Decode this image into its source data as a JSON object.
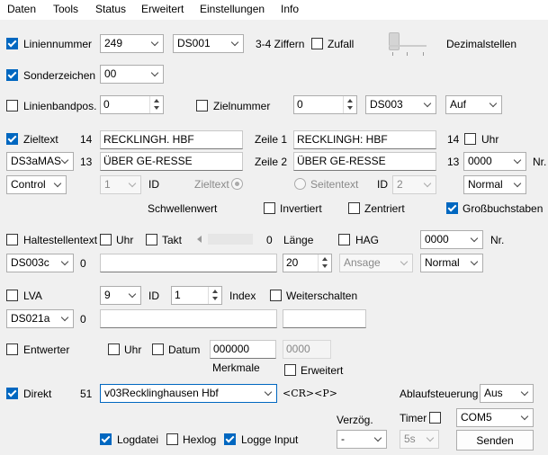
{
  "menu": [
    "Daten",
    "Tools",
    "Status",
    "Erweitert",
    "Einstellungen",
    "Info"
  ],
  "row1": {
    "label": "Liniennummer",
    "value": "249",
    "ds": "DS001",
    "hint": "3-4 Ziffern",
    "zufall": "Zufall",
    "dezimal": "Dezimalstellen"
  },
  "row2": {
    "label": "Sonderzeichen",
    "value": "00"
  },
  "row3": {
    "label": "Linienbandpos.",
    "value": "0",
    "zielnummer_label": "Zielnummer",
    "zielnummer_value": "0",
    "ds": "DS003",
    "mode": "Auf"
  },
  "row4": {
    "label": "Zieltext",
    "count1": "14",
    "text1": "RECKLINGH. HBF",
    "zeile1": "Zeile 1",
    "text2": "RECKLINGH: HBF",
    "count2": "14",
    "uhr": "Uhr"
  },
  "row5": {
    "ds": "DS3aMAS",
    "count1": "13",
    "text1": "ÜBER GE-RESSE",
    "zeile2": "Zeile 2",
    "text2": "ÜBER GE-RESSE",
    "count2": "13",
    "nr_value": "0000",
    "nr_label": "Nr."
  },
  "row6": {
    "control": "Control",
    "id_value": "1",
    "id_label": "ID",
    "zieltext": "Zieltext",
    "seitentext": "Seitentext",
    "id2_label": "ID",
    "id2_value": "2",
    "normal": "Normal"
  },
  "row7": {
    "schwellenwert": "Schwellenwert",
    "invertiert": "Invertiert",
    "zentriert": "Zentriert",
    "gross": "Großbuchstaben"
  },
  "row8": {
    "label": "Haltestellentext",
    "uhr": "Uhr",
    "takt": "Takt",
    "takt_value": "0",
    "laenge": "Länge",
    "hag": "HAG",
    "nr_value": "0000",
    "nr_label": "Nr."
  },
  "row9": {
    "ds": "DS003c",
    "count": "0",
    "spin_value": "20",
    "ansage": "Ansage",
    "normal": "Normal"
  },
  "row10": {
    "label": "LVA",
    "value": "9",
    "id_label": "ID",
    "id_value": "1",
    "index": "Index",
    "weiterschalten": "Weiterschalten"
  },
  "row11": {
    "ds": "DS021a",
    "count": "0"
  },
  "row12": {
    "label": "Entwerter",
    "uhr": "Uhr",
    "datum": "Datum",
    "merkmal_value": "000000",
    "merkmal_label": "Merkmale",
    "gray_value": "0000",
    "erweitert": "Erweitert"
  },
  "row13": {
    "label": "Direkt",
    "count": "51",
    "value": "v03Recklinghausen Hbf",
    "cr": "<CR><P>",
    "ablauf": "Ablaufsteuerung",
    "ablauf_value": "Aus"
  },
  "row14": {
    "verzoeg": "Verzög.",
    "timer": "Timer",
    "port": "COM5",
    "logdatei": "Logdatei",
    "hexlog": "Hexlog",
    "logge": "Logge Input",
    "verz_value": "-",
    "timer_value": "5s",
    "senden": "Senden"
  }
}
